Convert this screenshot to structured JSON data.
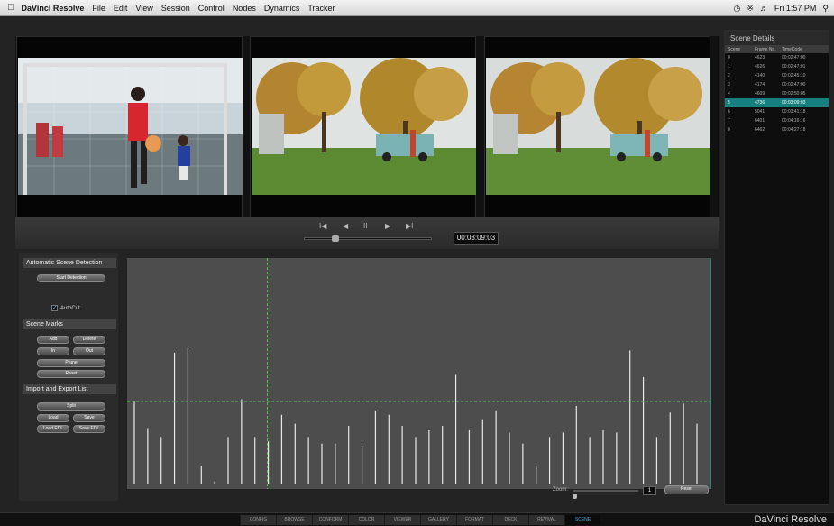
{
  "menubar": {
    "app_name": "DaVinci Resolve",
    "items": [
      "File",
      "Edit",
      "View",
      "Session",
      "Control",
      "Nodes",
      "Dynamics",
      "Tracker"
    ],
    "clock": "Fri 1:57 PM"
  },
  "transport": {
    "buttons": [
      "I◀",
      "◀",
      "II",
      "▶",
      "▶I"
    ],
    "timecode": "00:03:09:03"
  },
  "scene_details": {
    "title": "Scene Details",
    "columns": [
      "Scene",
      "Frame No.",
      "TimeCode"
    ],
    "rows": [
      [
        "0",
        "4623",
        "00:02:47:00"
      ],
      [
        "1",
        "4626",
        "00:02:47:01"
      ],
      [
        "2",
        "4140",
        "00:02:45:10"
      ],
      [
        "3",
        "4174",
        "00:02:47:00"
      ],
      [
        "4",
        "4609",
        "00:02:50:05"
      ],
      [
        "5",
        "4736",
        "00:03:09:03"
      ],
      [
        "6",
        "5041",
        "00:03:41:18"
      ],
      [
        "7",
        "6401",
        "00:04:16:16"
      ],
      [
        "8",
        "6462",
        "00:04:27:18"
      ]
    ],
    "selected_index": 5
  },
  "left_panel": {
    "auto_detect_title": "Automatic Scene Detection",
    "start_detection": "Start Detection",
    "autocut_label": "AutoCut",
    "autocut_checked": true,
    "scene_marks_title": "Scene Marks",
    "add": "Add",
    "delete": "Delete",
    "in": "In",
    "out": "Out",
    "prune": "Prune",
    "reset": "Reset",
    "import_export_title": "Import and Export List",
    "split": "Split",
    "load": "Load",
    "save": "Save",
    "load_edl": "Load EDL",
    "save_edl": "Save EDL"
  },
  "zoom": {
    "label": "Zoom:",
    "value": "1",
    "reset": "Reset"
  },
  "tabs": [
    "CONFIG",
    "BROWSE",
    "CONFORM",
    "COLOR",
    "VIEWER",
    "GALLERY",
    "FORMAT",
    "DECK",
    "REVIVAL",
    "SCENE"
  ],
  "active_tab": "SCENE",
  "brand": "DaVinci Resolve",
  "colors": {
    "accent": "#4ab0e8",
    "selection": "#167f80",
    "threshold": "#3cd13c"
  },
  "chart_data": {
    "type": "bar",
    "threshold": 0.37,
    "cursor_position": 0.24,
    "values": [
      0.37,
      0.25,
      0.21,
      0.59,
      0.61,
      0.08,
      0.01,
      0.21,
      0.38,
      0.21,
      0.19,
      0.31,
      0.27,
      0.21,
      0.18,
      0.18,
      0.26,
      0.17,
      0.33,
      0.31,
      0.26,
      0.21,
      0.24,
      0.26,
      0.49,
      0.24,
      0.29,
      0.33,
      0.23,
      0.18,
      0.08,
      0.21,
      0.23,
      0.35,
      0.21,
      0.24,
      0.23,
      0.6,
      0.48,
      0.21,
      0.32,
      0.36,
      0.27
    ]
  }
}
